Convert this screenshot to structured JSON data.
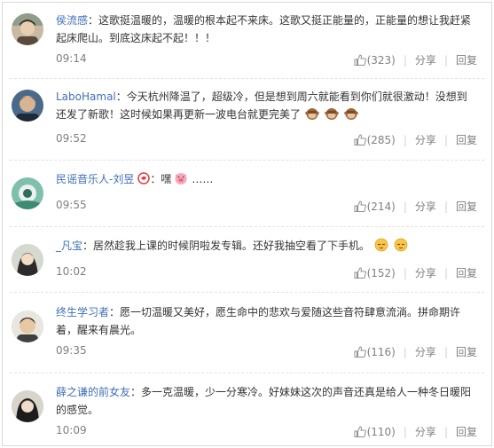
{
  "comments": [
    {
      "user": "侯流感",
      "text": "这歌挺温暖的，温暖的根本起不来床。这歌又挺正能量的，正能量的想让我赶紧起床爬山。到底这床起不起！！！",
      "time": "09:14",
      "likes": "(323)",
      "share": "分享",
      "reply": "回复"
    },
    {
      "user": "LaboHamal",
      "text": "今天杭州降温了，超级冷，但是想到周六就能看到你们就很激动！没想到还发了新歌！这时候如果再更新一波电台就更完美了",
      "emoji": [
        "monkey-see-no-evil",
        "monkey-see-no-evil",
        "monkey-see-no-evil"
      ],
      "time": "09:52",
      "likes": "(285)",
      "share": "分享",
      "reply": "回复"
    },
    {
      "user": "民谣音乐人-刘昱",
      "text": "嘿",
      "text_after": "……",
      "time": "09:55",
      "likes": "(214)",
      "share": "分享",
      "reply": "回复"
    },
    {
      "user": "_凡宝",
      "text": "居然趁我上课的时候阴啦发专辑。还好我抽空看了下手机。",
      "time": "10:02",
      "likes": "(152)",
      "share": "分享",
      "reply": "回复"
    },
    {
      "user": "终生学习者",
      "text": "愿一切温暖又美好，愿生命中的悲欢与爱随这些音符肆意流淌。拼命期许着，醒来有晨光。",
      "time": "09:35",
      "likes": "(116)",
      "share": "分享",
      "reply": "回复"
    },
    {
      "user": "薛之谦的前女友",
      "text": "多一克温暖，少一分寒冷。好妹妹这次的声音还真是给人一种冬日暖阳的感觉。",
      "time": "10:09",
      "likes": "(110)",
      "share": "分享",
      "reply": "回复"
    }
  ],
  "colors": {
    "username": "#3f6fb5",
    "meta": "#808080",
    "text": "#333333"
  },
  "icons": {
    "like": "thumbs-up-icon",
    "verified": "weibo-verified-icon",
    "pig": "pig-face-emoji",
    "sleepy": "sleepy-face-emoji"
  }
}
